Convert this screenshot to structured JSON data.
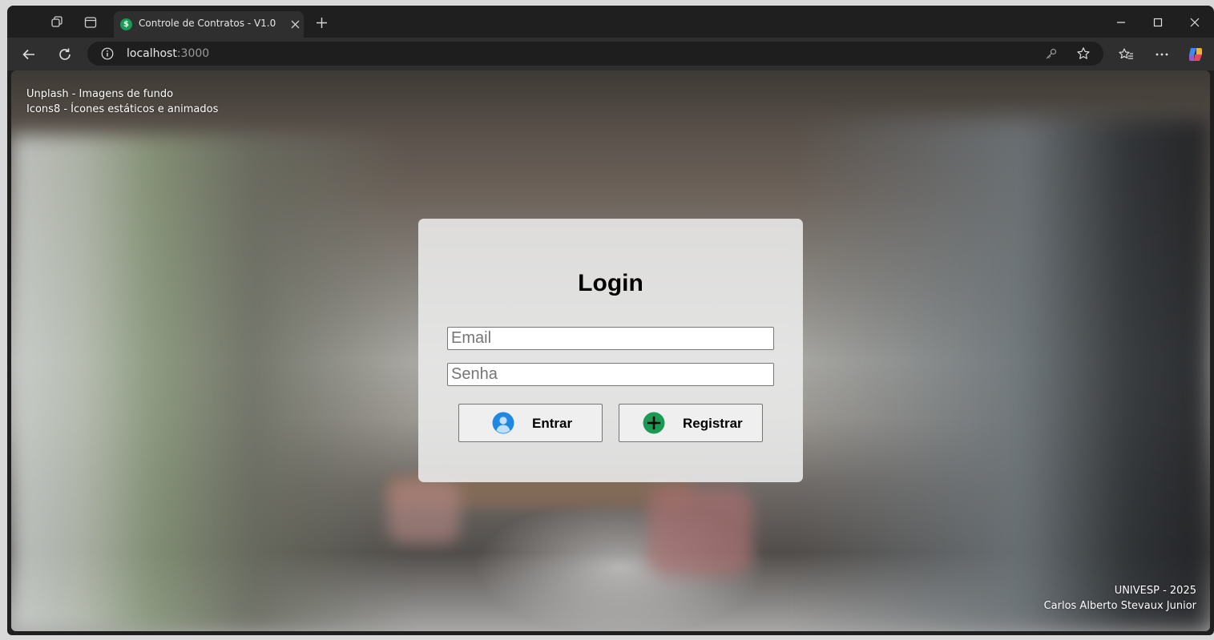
{
  "browser": {
    "tab": {
      "title": "Controle de Contratos - V1.0",
      "favicon_letter": "$"
    },
    "address": {
      "host": "localhost",
      "port": ":3000"
    }
  },
  "page": {
    "credits": [
      "Unplash - Imagens de fundo",
      "Icons8 - Ícones estáticos e animados"
    ],
    "login": {
      "title": "Login",
      "email_placeholder": "Email",
      "password_placeholder": "Senha",
      "enter_label": "Entrar",
      "register_label": "Registrar"
    },
    "footer": {
      "line1": "UNIVESP - 2025",
      "line2": "Carlos Alberto Stevaux Junior"
    }
  },
  "colors": {
    "favicon": "#1a9a52",
    "user_icon": "#1e88e5",
    "add_icon": "#1a9a52"
  }
}
